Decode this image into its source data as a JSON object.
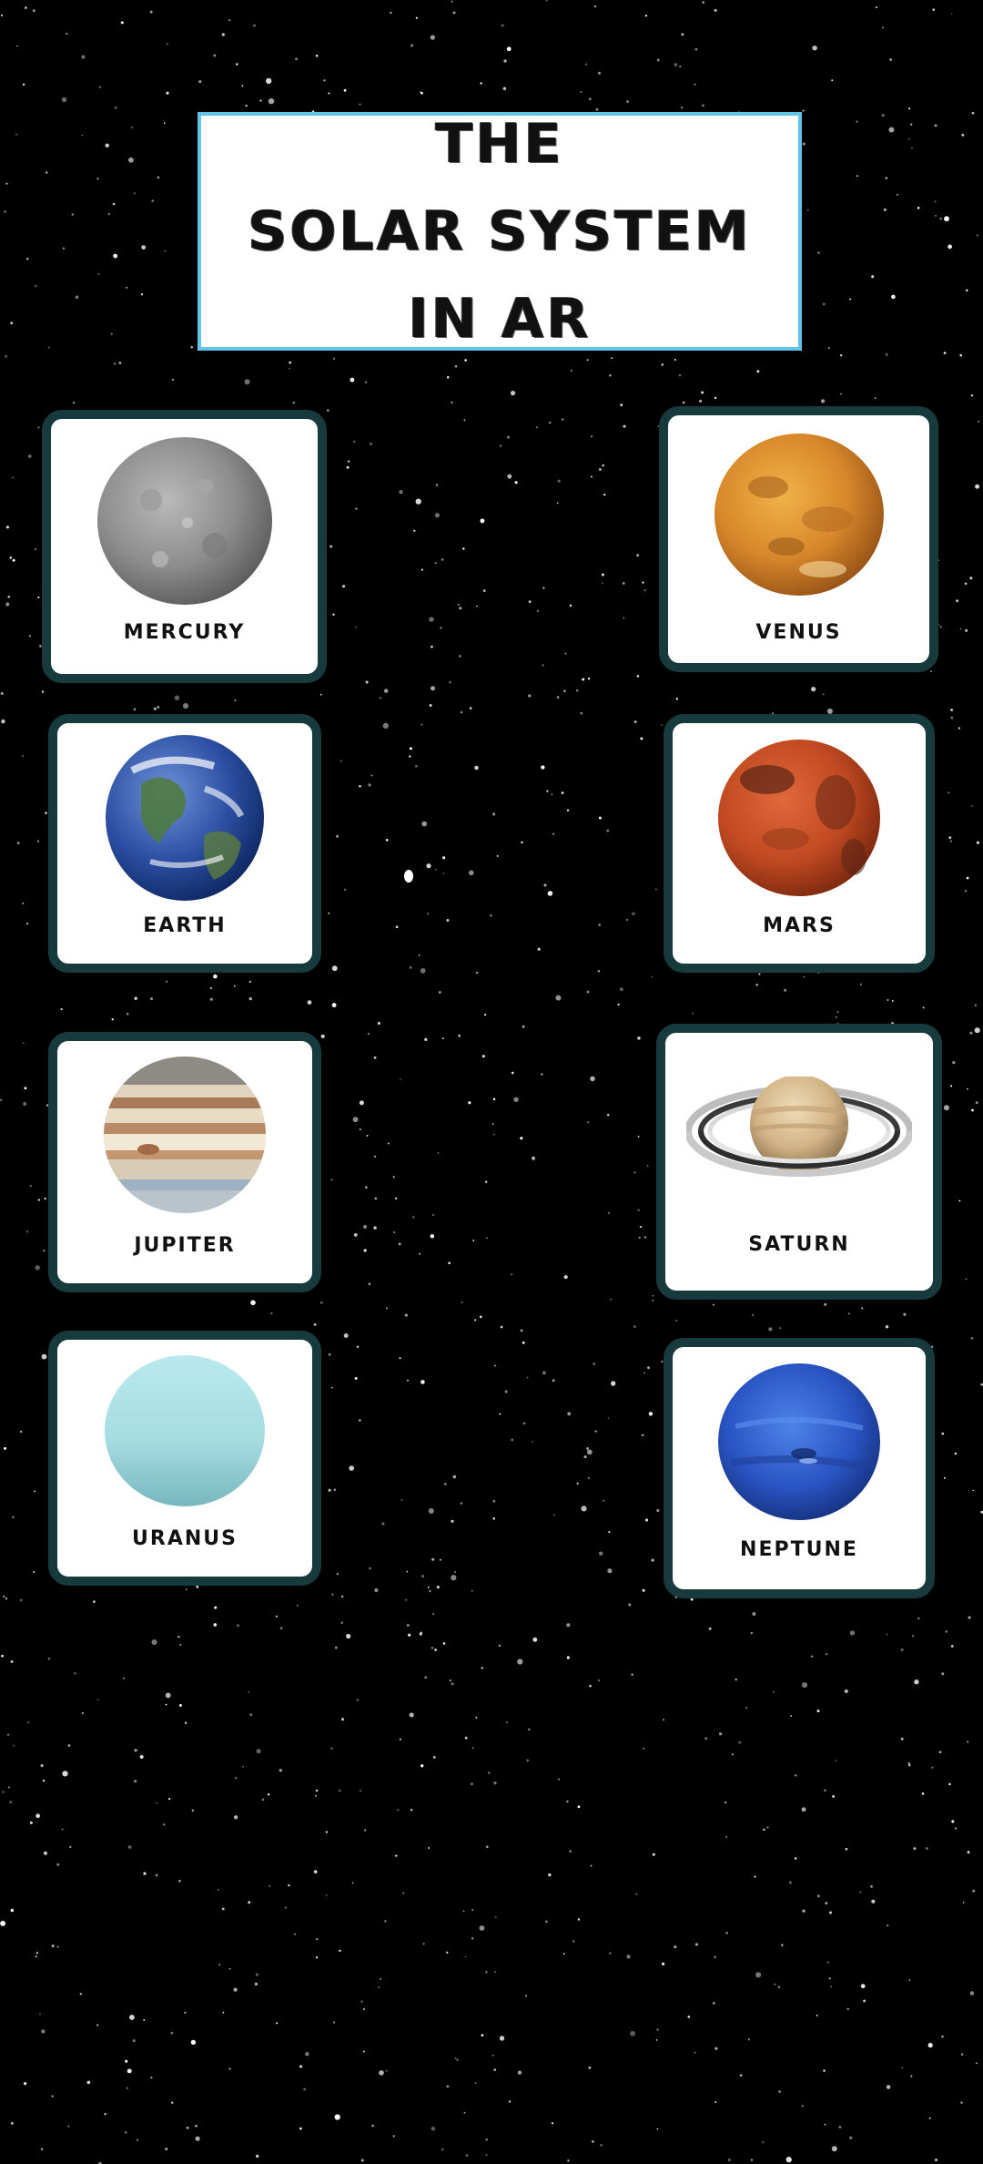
{
  "title": {
    "line1": "THE",
    "line2": "SOLAR SYSTEM",
    "line3": "IN AR"
  },
  "planets": [
    {
      "id": "mercury",
      "label": "MERCURY",
      "icon": "mercury-icon"
    },
    {
      "id": "venus",
      "label": "VENUS",
      "icon": "venus-icon"
    },
    {
      "id": "earth",
      "label": "EARTH",
      "icon": "earth-icon"
    },
    {
      "id": "mars",
      "label": "MARS",
      "icon": "mars-icon"
    },
    {
      "id": "jupiter",
      "label": "JUPITER",
      "icon": "jupiter-icon"
    },
    {
      "id": "saturn",
      "label": "SATURN",
      "icon": "saturn-icon"
    },
    {
      "id": "uranus",
      "label": "URANUS",
      "icon": "uranus-icon"
    },
    {
      "id": "neptune",
      "label": "NEPTUNE",
      "icon": "neptune-icon"
    }
  ],
  "colors": {
    "background": "#000000",
    "title_border": "#63c3e6",
    "card_border": "#173b3c",
    "card_fill": "#ffffff"
  }
}
